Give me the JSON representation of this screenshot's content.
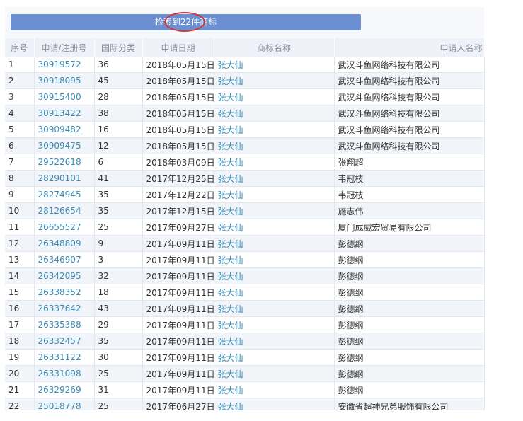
{
  "banner": {
    "text": "检索到22件商标",
    "highlight_color": "#d2343c",
    "bg_color": "#6b8fd1"
  },
  "table": {
    "headers": [
      "序号",
      "申请/注册号",
      "国际分类",
      "申请日期",
      "商标名称",
      "申请人名称"
    ],
    "rows": [
      [
        "1",
        "30919572",
        "36",
        "2018年05月15日",
        "张大仙",
        "武汉斗鱼网络科技有限公司"
      ],
      [
        "2",
        "30918095",
        "45",
        "2018年05月15日",
        "张大仙",
        "武汉斗鱼网络科技有限公司"
      ],
      [
        "3",
        "30915400",
        "28",
        "2018年05月15日",
        "张大仙",
        "武汉斗鱼网络科技有限公司"
      ],
      [
        "4",
        "30913422",
        "38",
        "2018年05月15日",
        "张大仙",
        "武汉斗鱼网络科技有限公司"
      ],
      [
        "5",
        "30909482",
        "16",
        "2018年05月15日",
        "张大仙",
        "武汉斗鱼网络科技有限公司"
      ],
      [
        "6",
        "30909475",
        "12",
        "2018年05月15日",
        "张大仙",
        "武汉斗鱼网络科技有限公司"
      ],
      [
        "7",
        "29522618",
        "6",
        "2018年03月09日",
        "张大仙",
        "张翔超"
      ],
      [
        "8",
        "28290101",
        "41",
        "2017年12月25日",
        "张大仙",
        "韦冠枝"
      ],
      [
        "9",
        "28274945",
        "35",
        "2017年12月22日",
        "张大仙",
        "韦冠枝"
      ],
      [
        "10",
        "28126654",
        "35",
        "2017年12月15日",
        "张大仙",
        "施志伟"
      ],
      [
        "11",
        "26655527",
        "25",
        "2017年09月27日",
        "张大仙",
        "厦门成威宏贸易有限公司"
      ],
      [
        "12",
        "26348809",
        "9",
        "2017年09月11日",
        "张大仙",
        "彭德纲"
      ],
      [
        "13",
        "26346907",
        "3",
        "2017年09月11日",
        "张大仙",
        "彭德纲"
      ],
      [
        "14",
        "26342095",
        "32",
        "2017年09月11日",
        "张大仙",
        "彭德纲"
      ],
      [
        "15",
        "26338352",
        "18",
        "2017年09月11日",
        "张大仙",
        "彭德纲"
      ],
      [
        "16",
        "26337642",
        "43",
        "2017年09月11日",
        "张大仙",
        "彭德纲"
      ],
      [
        "17",
        "26335388",
        "29",
        "2017年09月11日",
        "张大仙",
        "彭德纲"
      ],
      [
        "18",
        "26332457",
        "35",
        "2017年09月11日",
        "张大仙",
        "彭德纲"
      ],
      [
        "19",
        "26331122",
        "30",
        "2017年09月11日",
        "张大仙",
        "彭德纲"
      ],
      [
        "20",
        "26331098",
        "25",
        "2017年09月11日",
        "张大仙",
        "彭德纲"
      ],
      [
        "21",
        "26329269",
        "31",
        "2017年09月11日",
        "张大仙",
        "彭德纲"
      ],
      [
        "22",
        "25018778",
        "25",
        "2017年06月27日",
        "张大仙",
        "安徽省超神兄弟服饰有限公司"
      ]
    ]
  }
}
